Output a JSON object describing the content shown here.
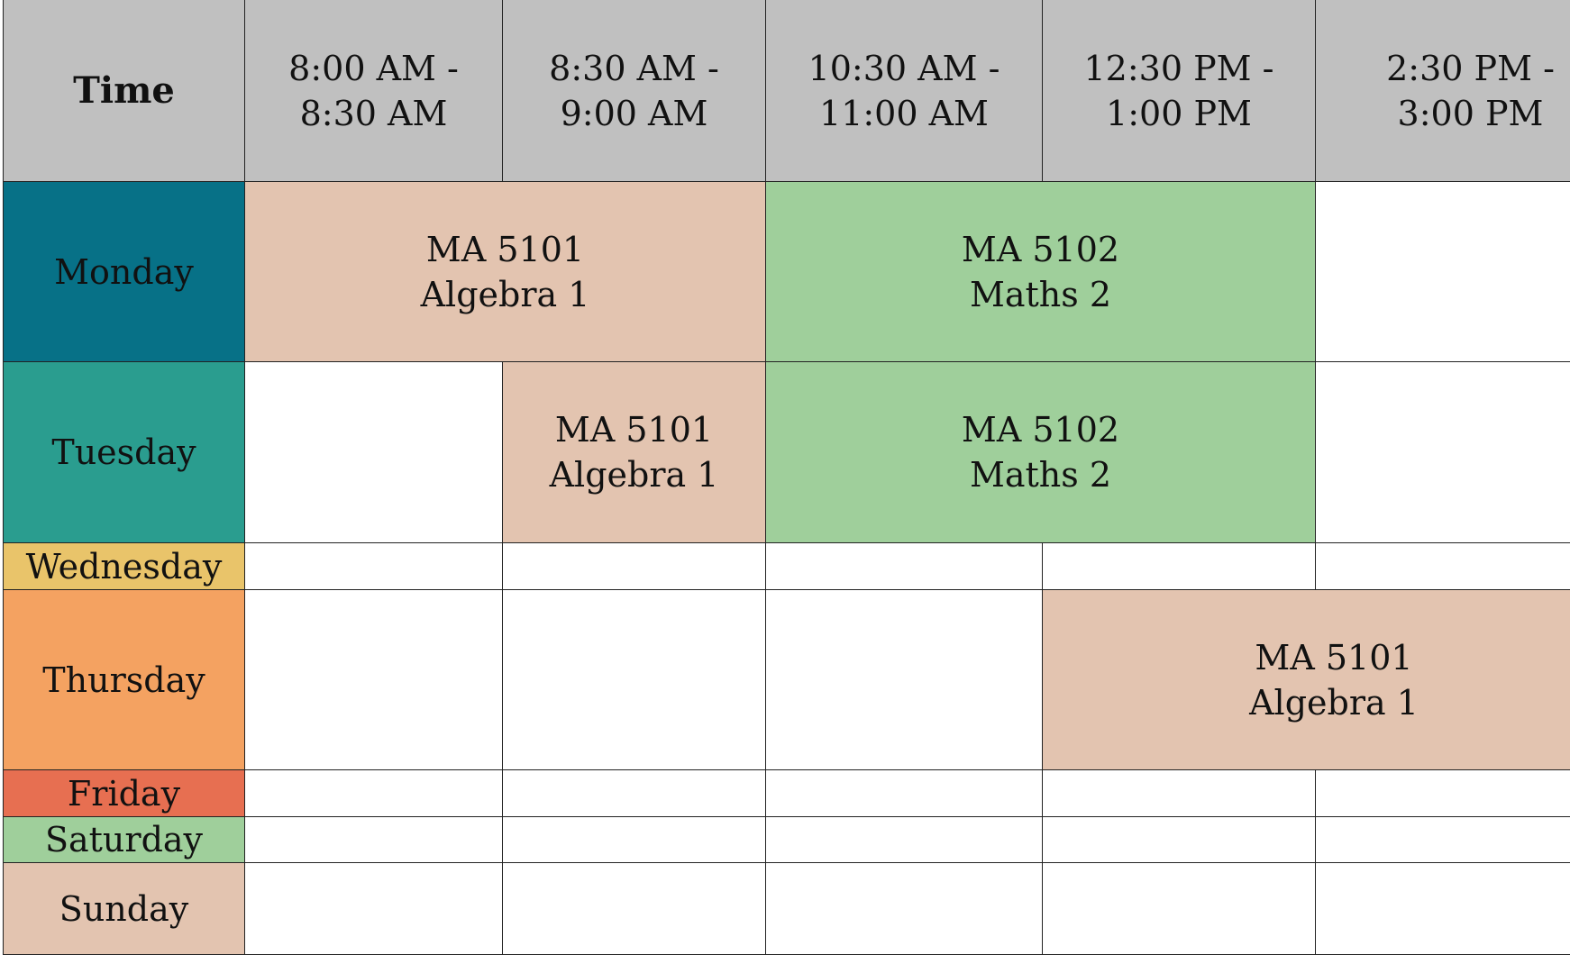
{
  "header": {
    "corner_label": "Time",
    "time_slots": [
      "8:00 AM -\n8:30 AM",
      "8:30 AM -\n9:00 AM",
      "10:30 AM -\n11:00 AM",
      "12:30 PM -\n1:00 PM",
      "2:30 PM -\n3:00 PM"
    ]
  },
  "colors": {
    "header_bg": "#c0c0c0",
    "algebra": "#e3c4b0",
    "maths": "#9fcf9b"
  },
  "days": [
    {
      "name": "Monday",
      "color": "#077187",
      "sessions": [
        {
          "start": 0,
          "span": 2,
          "code": "MA 5101",
          "title": "Algebra 1",
          "color": "#e3c4b0"
        },
        {
          "start": 2,
          "span": 2,
          "code": "MA 5102",
          "title": "Maths 2",
          "color": "#9fcf9b"
        }
      ]
    },
    {
      "name": "Tuesday",
      "color": "#2a9d8f",
      "sessions": [
        {
          "start": 1,
          "span": 1,
          "code": "MA 5101",
          "title": "Algebra 1",
          "color": "#e3c4b0"
        },
        {
          "start": 2,
          "span": 2,
          "code": "MA 5102",
          "title": "Maths 2",
          "color": "#9fcf9b"
        }
      ]
    },
    {
      "name": "Wednesday",
      "color": "#e9c46a",
      "sessions": []
    },
    {
      "name": "Thursday",
      "color": "#f4a261",
      "sessions": [
        {
          "start": 3,
          "span": 2,
          "code": "MA 5101",
          "title": "Algebra 1",
          "color": "#e3c4b0"
        }
      ]
    },
    {
      "name": "Friday",
      "color": "#e76f51",
      "sessions": []
    },
    {
      "name": "Saturday",
      "color": "#9fcf9b",
      "sessions": []
    },
    {
      "name": "Sunday",
      "color": "#e3c4b0",
      "sessions": []
    }
  ]
}
